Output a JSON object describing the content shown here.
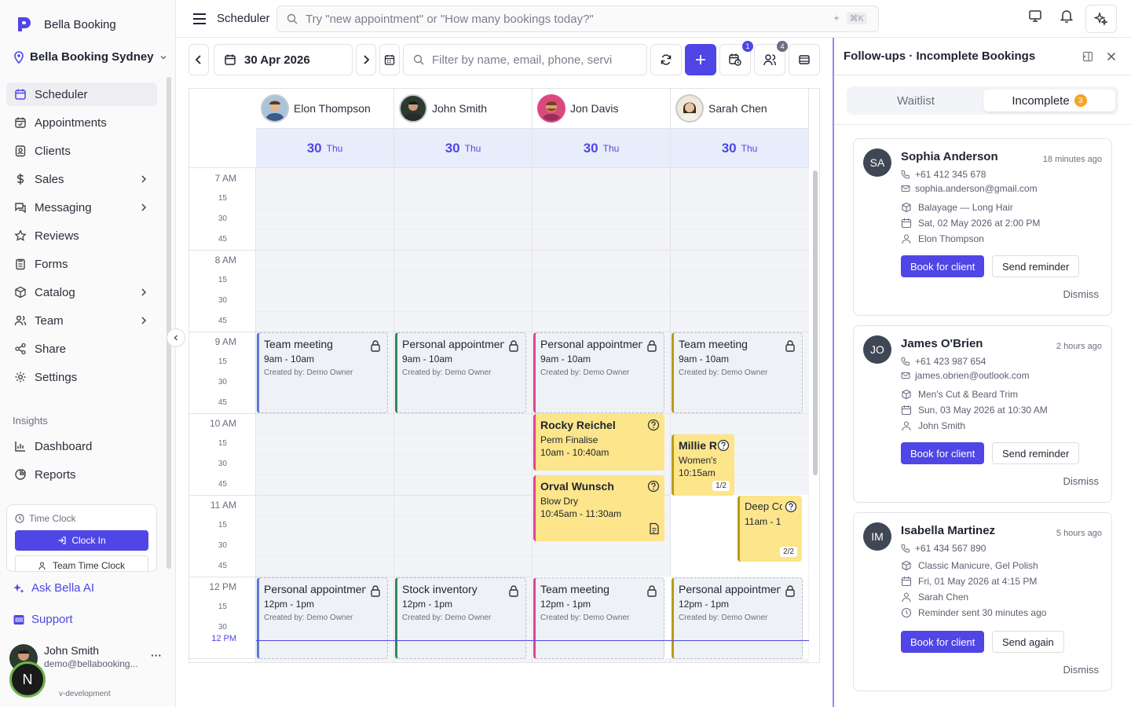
{
  "brand": {
    "name": "Bella Booking",
    "accent": "#4f46e5"
  },
  "location": {
    "name": "Bella Booking Sydney"
  },
  "nav": {
    "items": [
      {
        "label": "Scheduler",
        "icon": "calendar-icon",
        "active": true
      },
      {
        "label": "Appointments",
        "icon": "calendar-check-icon"
      },
      {
        "label": "Clients",
        "icon": "contact-icon"
      },
      {
        "label": "Sales",
        "icon": "dollar-icon",
        "chevron": true
      },
      {
        "label": "Messaging",
        "icon": "message-icon",
        "chevron": true
      },
      {
        "label": "Reviews",
        "icon": "star-icon"
      },
      {
        "label": "Forms",
        "icon": "clipboard-icon"
      },
      {
        "label": "Catalog",
        "icon": "box-icon",
        "chevron": true
      },
      {
        "label": "Team",
        "icon": "users-icon",
        "chevron": true
      },
      {
        "label": "Share",
        "icon": "share-icon"
      },
      {
        "label": "Settings",
        "icon": "gear-icon"
      }
    ],
    "insights_label": "Insights",
    "insights": [
      {
        "label": "Dashboard",
        "icon": "bar-chart-icon"
      },
      {
        "label": "Reports",
        "icon": "pie-chart-icon"
      }
    ]
  },
  "timeclock": {
    "title": "Time Clock",
    "clock_in": "Clock In",
    "team": "Team Time Clock"
  },
  "ask_ai": "Ask Bella AI",
  "support": "Support",
  "user": {
    "name": "John Smith",
    "email": "demo@bellabooking...",
    "menu": "···",
    "overlay_initial": "N"
  },
  "version": "v-development",
  "topbar": {
    "title": "Scheduler",
    "search_placeholder": "Try \"new appointment\" or \"How many bookings today?\"",
    "shortcut": "⌘K"
  },
  "toolbar": {
    "date": "30 Apr 2026",
    "filter_placeholder": "Filter by name, email, phone, service",
    "badge_waitlist": "1",
    "badge_staff": "4"
  },
  "grid": {
    "staff": [
      {
        "name": "Elon Thompson",
        "color": "#5b7bd5"
      },
      {
        "name": "John Smith",
        "color": "#2e8b57"
      },
      {
        "name": "Jon Davis",
        "color": "#e0458f"
      },
      {
        "name": "Sarah Chen",
        "color": "#b89b1a"
      }
    ],
    "day_num": "30",
    "day_name": "Thu",
    "hours": [
      "7 AM",
      "8 AM",
      "9 AM",
      "10 AM",
      "11 AM",
      "12 PM"
    ],
    "quarters": [
      "15",
      "30",
      "45"
    ],
    "now_label": "12 PM",
    "created_by": "Created by: Demo Owner",
    "blocks": [
      {
        "title": "Team meeting",
        "time": "9am - 10am"
      },
      {
        "title": "Personal appointment",
        "time": "9am - 10am"
      },
      {
        "title": "Personal appointment",
        "time": "9am - 10am"
      },
      {
        "title": "Team meeting",
        "time": "9am - 10am"
      },
      {
        "title": "Personal appointment",
        "time": "12pm - 1pm"
      },
      {
        "title": "Stock inventory",
        "time": "12pm - 1pm"
      },
      {
        "title": "Team meeting",
        "time": "12pm - 1pm"
      },
      {
        "title": "Personal appointment",
        "time": "12pm - 1pm"
      }
    ],
    "appointments": [
      {
        "name": "Rocky Reichel",
        "service": "Perm Finalise",
        "time": "10am - 10:40am"
      },
      {
        "name": "Orval Wunsch",
        "service": "Blow Dry",
        "time": "10:45am - 11:30am"
      },
      {
        "name": "Millie R",
        "service": "Women's",
        "time": "10:15am",
        "pager": "1/2"
      },
      {
        "name": "Deep Cc",
        "service": "",
        "time": "11am - 1",
        "pager": "2/2"
      }
    ]
  },
  "panel": {
    "title": "Follow-ups · Incomplete Bookings",
    "tab_waitlist": "Waitlist",
    "tab_incomplete": "Incomplete",
    "incomplete_count": "3",
    "cards": [
      {
        "initials": "SA",
        "name": "Sophia Anderson",
        "ago": "18 minutes ago",
        "phone": "+61 412 345 678",
        "email": "sophia.anderson@gmail.com",
        "service": "Balayage — Long Hair",
        "date": "Sat, 02 May 2026 at 2:00 PM",
        "staff": "Elon Thompson",
        "primary": "Book for client",
        "secondary": "Send reminder",
        "dismiss": "Dismiss"
      },
      {
        "initials": "JO",
        "name": "James O'Brien",
        "ago": "2 hours ago",
        "phone": "+61 423 987 654",
        "email": "james.obrien@outlook.com",
        "service": "Men's Cut & Beard Trim",
        "date": "Sun, 03 May 2026 at 10:30 AM",
        "staff": "John Smith",
        "primary": "Book for client",
        "secondary": "Send reminder",
        "dismiss": "Dismiss"
      },
      {
        "initials": "IM",
        "name": "Isabella Martinez",
        "ago": "5 hours ago",
        "phone": "+61 434 567 890",
        "service": "Classic Manicure, Gel Polish",
        "date": "Fri, 01 May 2026 at 4:15 PM",
        "staff": "Sarah Chen",
        "reminder": "Reminder sent 30 minutes ago",
        "primary": "Book for client",
        "secondary": "Send again",
        "dismiss": "Dismiss"
      }
    ]
  }
}
